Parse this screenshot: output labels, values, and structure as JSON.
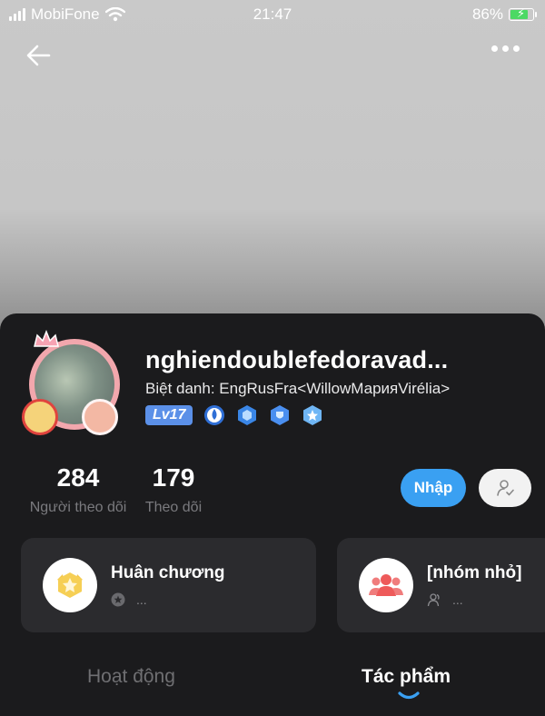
{
  "status_bar": {
    "carrier": "MobiFone",
    "time": "21:47",
    "battery_percent": "86%",
    "battery_level": 0.86
  },
  "header": {
    "back_icon": "back-arrow-icon",
    "more_icon": "more-dots-icon"
  },
  "profile": {
    "username": "nghiendoublefedoravad...",
    "nickname": "Biệt danh: EngRusFra<WillowМарияVirélia>",
    "level": "Lv17",
    "badges": [
      "water-drop-badge-icon",
      "hexagon-badge-icon",
      "shield-badge-icon",
      "star-badge-icon"
    ]
  },
  "stats": [
    {
      "value": "284",
      "label": "Người theo dõi"
    },
    {
      "value": "179",
      "label": "Theo dõi"
    }
  ],
  "actions": {
    "chat_label": "Nhập",
    "follow_icon": "user-check-icon"
  },
  "cards": [
    {
      "title": "Huân chương",
      "sub": "...",
      "icon": "medal-icon",
      "sub_icon": "star-circle-icon"
    },
    {
      "title": "[nhóm nhỏ]",
      "sub": "...",
      "icon": "group-icon",
      "sub_icon": "user-outline-icon"
    }
  ],
  "tabs": [
    {
      "label": "Hoạt động",
      "active": false
    },
    {
      "label": "Tác phẩm",
      "active": true
    }
  ],
  "colors": {
    "accent": "#3aa0f2",
    "panel_bg": "#1b1b1d",
    "card_bg": "#2b2b2e",
    "level_badge": "#5b90e8"
  }
}
